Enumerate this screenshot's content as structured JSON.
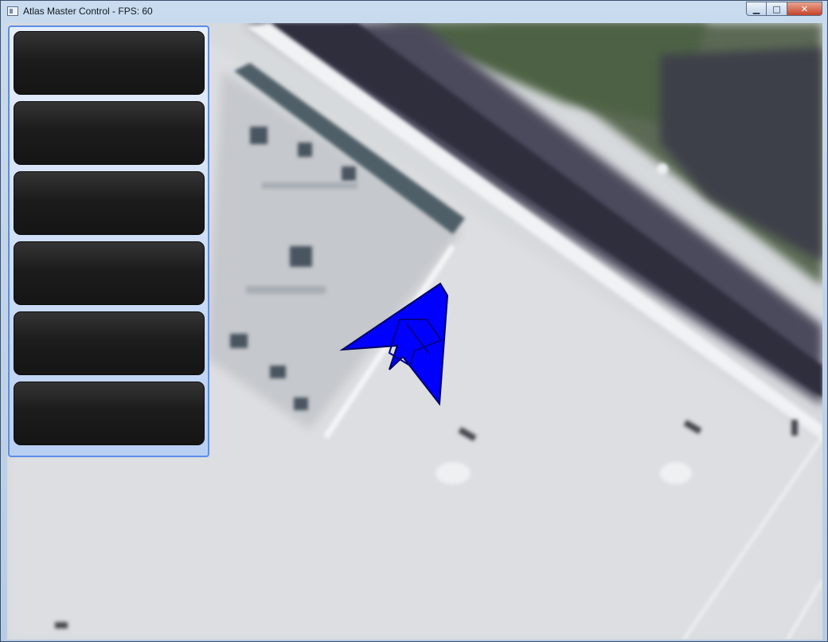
{
  "window": {
    "title": "Atlas Master Control - FPS: 60"
  },
  "controls": {
    "minimize": "▁",
    "maximize": "□",
    "close": "✕"
  },
  "panel": {
    "buttons": [
      {
        "label": ""
      },
      {
        "label": ""
      },
      {
        "label": ""
      },
      {
        "label": ""
      },
      {
        "label": ""
      },
      {
        "label": ""
      }
    ]
  },
  "map": {
    "aircraft_color": "#0000ff",
    "aircraft_icon": "jet-aircraft-icon"
  }
}
